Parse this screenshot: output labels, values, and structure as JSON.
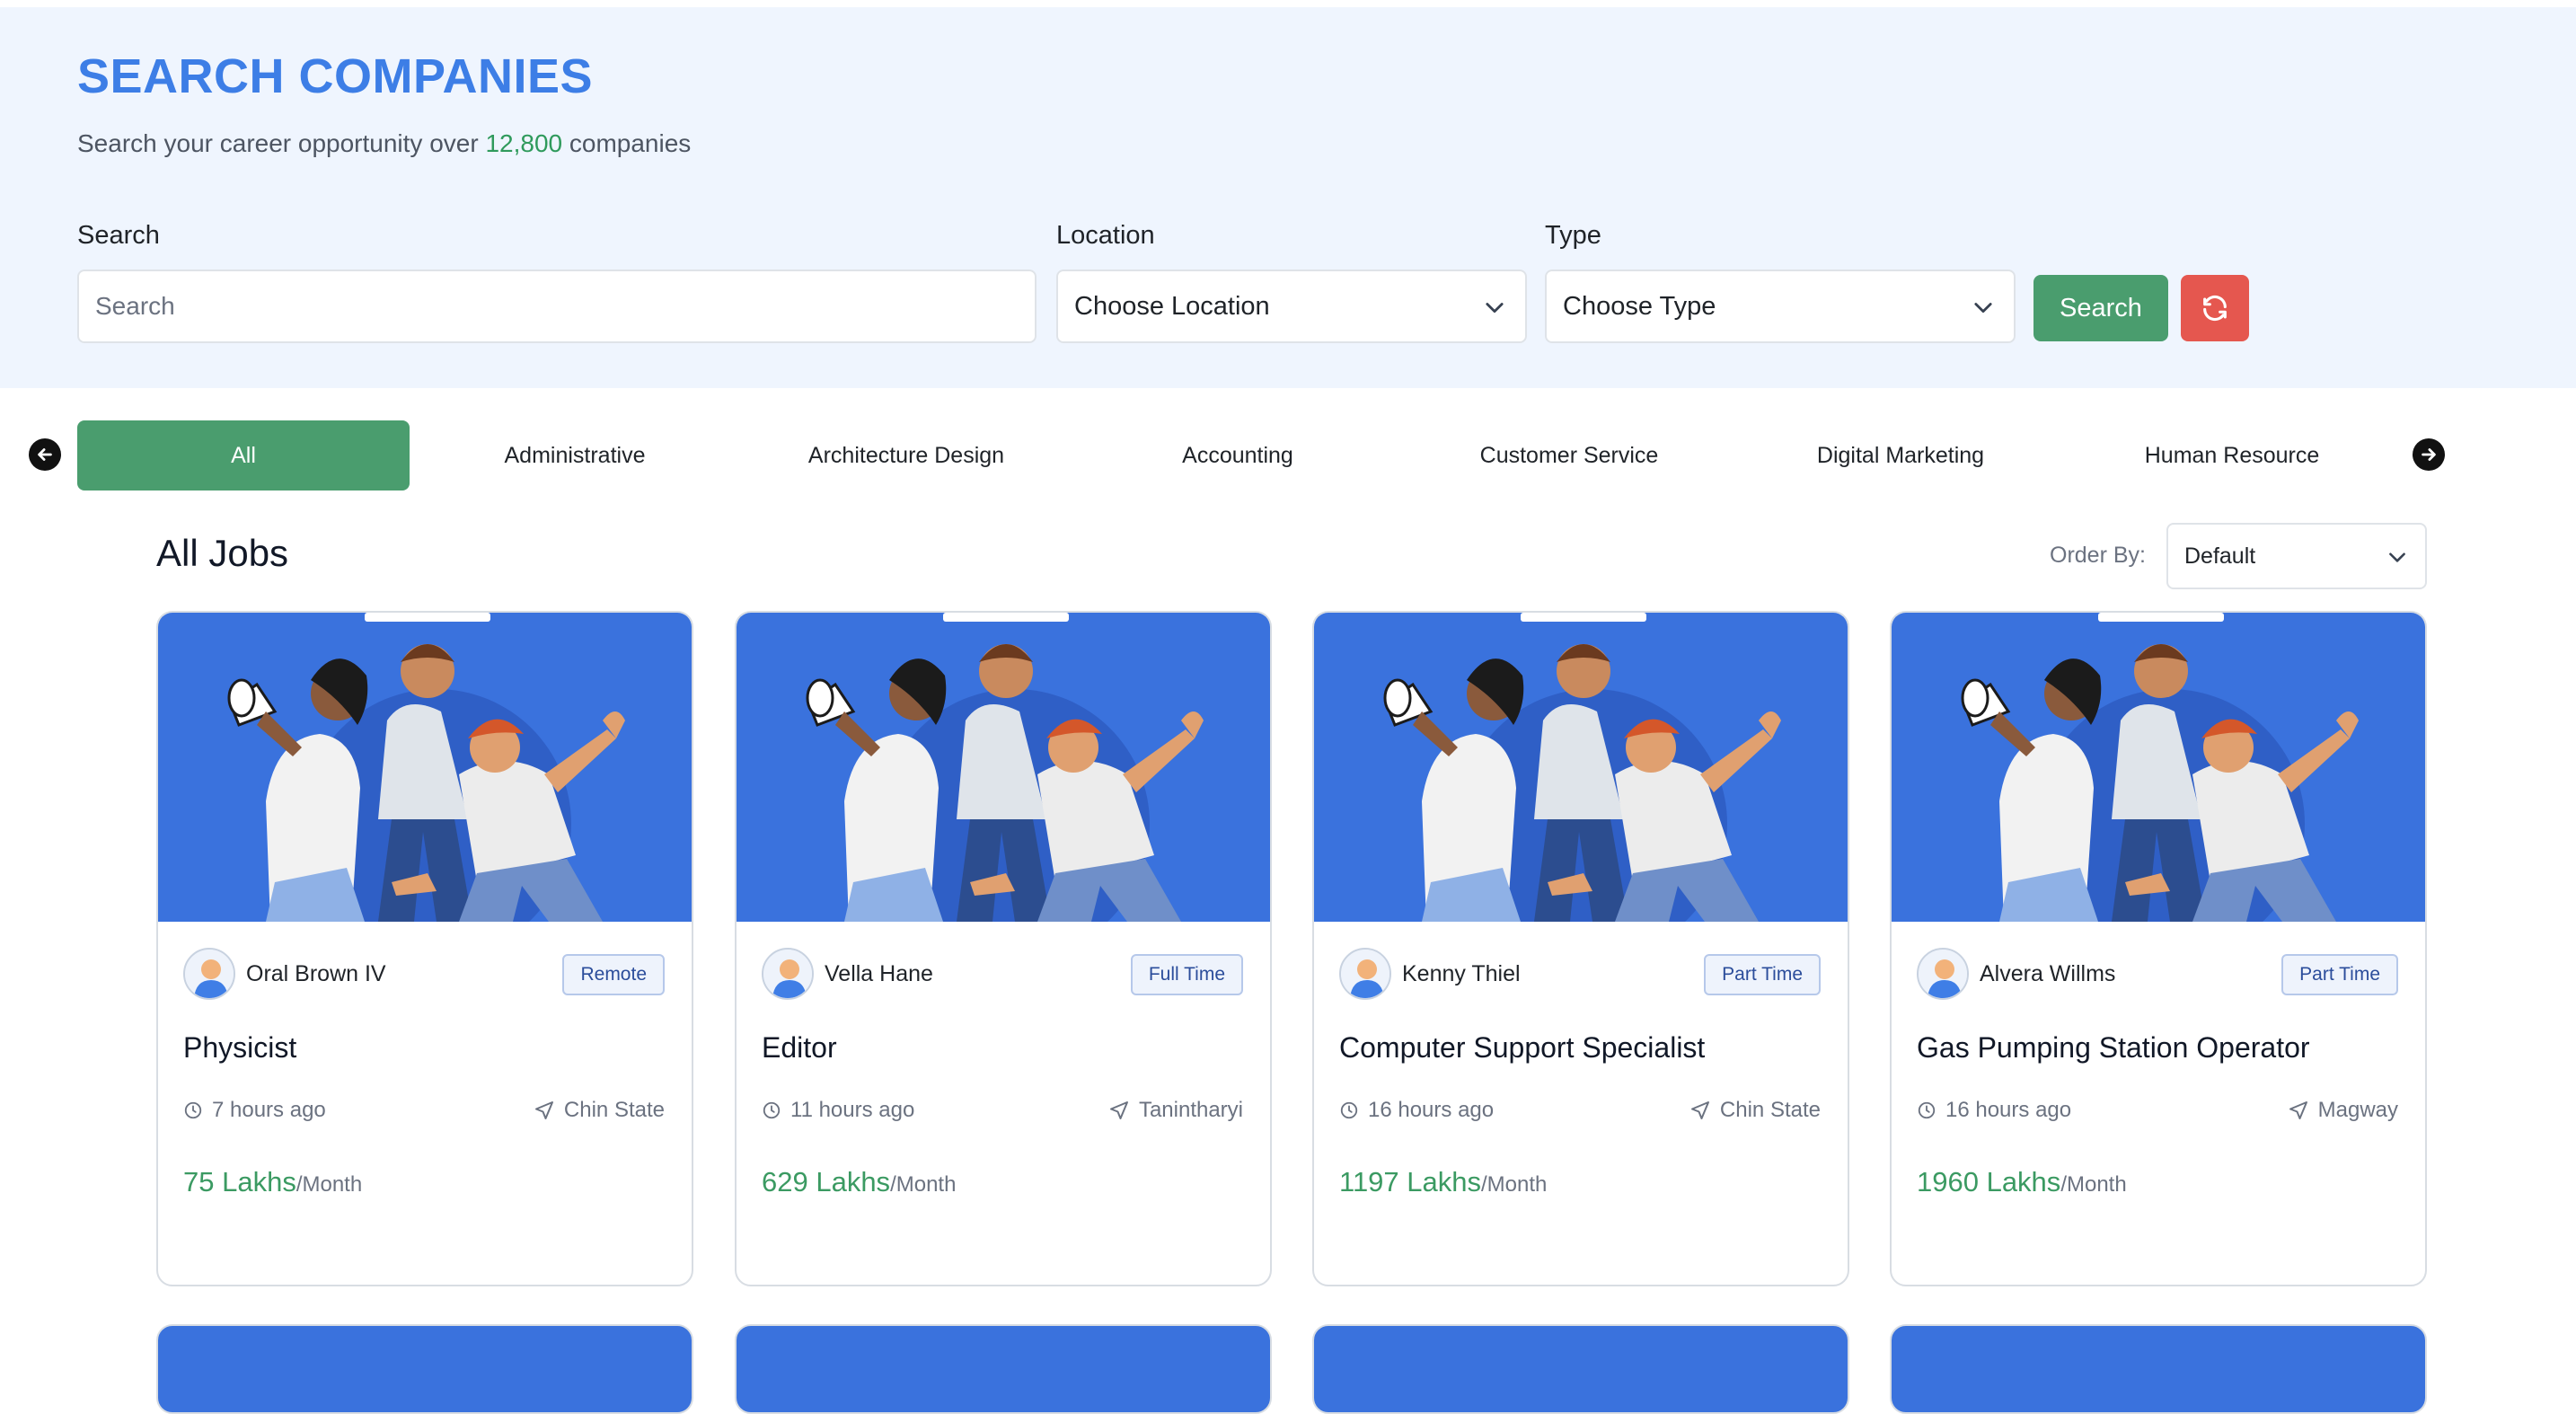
{
  "hero": {
    "title": "SEARCH COMPANIES",
    "subtitle_prefix": "Search your career opportunity over ",
    "subtitle_count": "12,800",
    "subtitle_suffix": " companies"
  },
  "filters": {
    "search_label": "Search",
    "search_placeholder": "Search",
    "location_label": "Location",
    "location_value": "Choose Location",
    "type_label": "Type",
    "type_value": "Choose Type",
    "search_button": "Search"
  },
  "categories": [
    "All",
    "Administrative",
    "Architecture Design",
    "Accounting",
    "Customer Service",
    "Digital Marketing",
    "Human Resource"
  ],
  "active_category": "All",
  "jobs_header": {
    "title": "All Jobs",
    "order_label": "Order By:",
    "order_value": "Default"
  },
  "jobs": [
    {
      "company": "Oral Brown IV",
      "type": "Remote",
      "title": "Physicist",
      "time": "7 hours ago",
      "location": "Chin State",
      "salary": "75 Lakhs",
      "per": "/Month"
    },
    {
      "company": "Vella Hane",
      "type": "Full Time",
      "title": "Editor",
      "time": "11 hours ago",
      "location": "Tanintharyi",
      "salary": "629 Lakhs",
      "per": "/Month"
    },
    {
      "company": "Kenny Thiel",
      "type": "Part Time",
      "title": "Computer Support Specialist",
      "time": "16 hours ago",
      "location": "Chin State",
      "salary": "1197 Lakhs",
      "per": "/Month"
    },
    {
      "company": "Alvera Willms",
      "type": "Part Time",
      "title": "Gas Pumping Station Operator",
      "time": "16 hours ago",
      "location": "Magway",
      "salary": "1960 Lakhs",
      "per": "/Month"
    }
  ],
  "colors": {
    "accent_blue": "#3d7ee6",
    "green": "#4a9d6e",
    "red": "#e5574f",
    "banner_blue": "#3a72dd"
  }
}
